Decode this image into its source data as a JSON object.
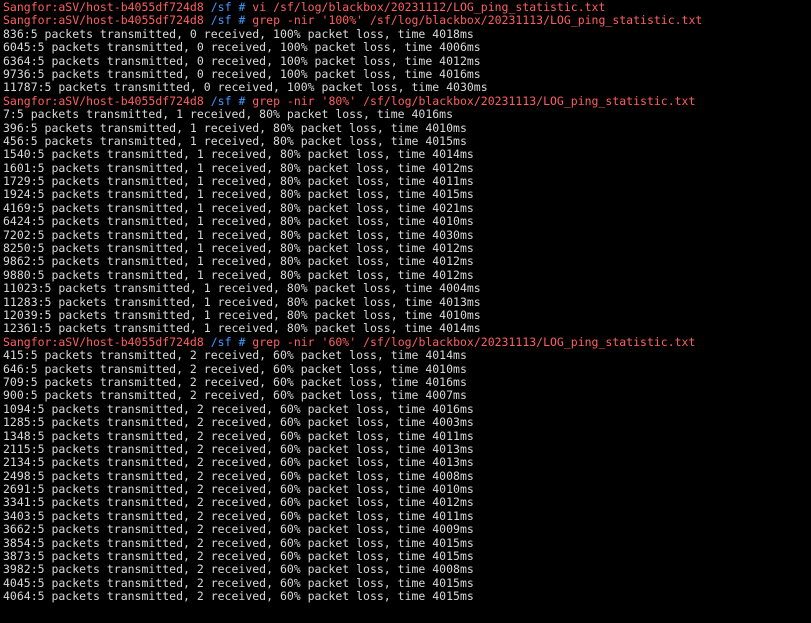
{
  "terminal": {
    "colors": {
      "background": "#000000",
      "text": "#d9d9d9",
      "prompt_host": "#ff5f5f",
      "prompt_path": "#3f9bff"
    },
    "lines": [
      {
        "type": "prompt",
        "host": "Sangfor:aSV/host-b4055df724d8",
        "path": "/sf",
        "cmd": "vi /sf/log/blackbox/20231112/LOG_ping_statistic.txt"
      },
      {
        "type": "prompt",
        "host": "Sangfor:aSV/host-b4055df724d8",
        "path": "/sf",
        "cmd": "grep -nir '100%' /sf/log/blackbox/20231113/LOG_ping_statistic.txt"
      },
      {
        "type": "out",
        "text": "836:5 packets transmitted, 0 received, 100% packet loss, time 4018ms"
      },
      {
        "type": "out",
        "text": "6045:5 packets transmitted, 0 received, 100% packet loss, time 4006ms"
      },
      {
        "type": "out",
        "text": "6364:5 packets transmitted, 0 received, 100% packet loss, time 4012ms"
      },
      {
        "type": "out",
        "text": "9736:5 packets transmitted, 0 received, 100% packet loss, time 4016ms"
      },
      {
        "type": "out",
        "text": "11787:5 packets transmitted, 0 received, 100% packet loss, time 4030ms"
      },
      {
        "type": "prompt",
        "host": "Sangfor:aSV/host-b4055df724d8",
        "path": "/sf",
        "cmd": "grep -nir '80%' /sf/log/blackbox/20231113/LOG_ping_statistic.txt"
      },
      {
        "type": "out",
        "text": "7:5 packets transmitted, 1 received, 80% packet loss, time 4016ms"
      },
      {
        "type": "out",
        "text": "396:5 packets transmitted, 1 received, 80% packet loss, time 4010ms"
      },
      {
        "type": "out",
        "text": "456:5 packets transmitted, 1 received, 80% packet loss, time 4015ms"
      },
      {
        "type": "out",
        "text": "1540:5 packets transmitted, 1 received, 80% packet loss, time 4014ms"
      },
      {
        "type": "out",
        "text": "1601:5 packets transmitted, 1 received, 80% packet loss, time 4012ms"
      },
      {
        "type": "out",
        "text": "1729:5 packets transmitted, 1 received, 80% packet loss, time 4011ms"
      },
      {
        "type": "out",
        "text": "1924:5 packets transmitted, 1 received, 80% packet loss, time 4015ms"
      },
      {
        "type": "out",
        "text": "4169:5 packets transmitted, 1 received, 80% packet loss, time 4021ms"
      },
      {
        "type": "out",
        "text": "6424:5 packets transmitted, 1 received, 80% packet loss, time 4010ms"
      },
      {
        "type": "out",
        "text": "7202:5 packets transmitted, 1 received, 80% packet loss, time 4030ms"
      },
      {
        "type": "out",
        "text": "8250:5 packets transmitted, 1 received, 80% packet loss, time 4012ms"
      },
      {
        "type": "out",
        "text": "9862:5 packets transmitted, 1 received, 80% packet loss, time 4012ms"
      },
      {
        "type": "out",
        "text": "9880:5 packets transmitted, 1 received, 80% packet loss, time 4012ms"
      },
      {
        "type": "out",
        "text": "11023:5 packets transmitted, 1 received, 80% packet loss, time 4004ms"
      },
      {
        "type": "out",
        "text": "11283:5 packets transmitted, 1 received, 80% packet loss, time 4013ms"
      },
      {
        "type": "out",
        "text": "12039:5 packets transmitted, 1 received, 80% packet loss, time 4010ms"
      },
      {
        "type": "out",
        "text": "12361:5 packets transmitted, 1 received, 80% packet loss, time 4014ms"
      },
      {
        "type": "prompt",
        "host": "Sangfor:aSV/host-b4055df724d8",
        "path": "/sf",
        "cmd": "grep -nir '60%' /sf/log/blackbox/20231113/LOG_ping_statistic.txt"
      },
      {
        "type": "out",
        "text": "415:5 packets transmitted, 2 received, 60% packet loss, time 4014ms"
      },
      {
        "type": "out",
        "text": "646:5 packets transmitted, 2 received, 60% packet loss, time 4010ms"
      },
      {
        "type": "out",
        "text": "709:5 packets transmitted, 2 received, 60% packet loss, time 4016ms"
      },
      {
        "type": "out",
        "text": "900:5 packets transmitted, 2 received, 60% packet loss, time 4007ms"
      },
      {
        "type": "out",
        "text": "1094:5 packets transmitted, 2 received, 60% packet loss, time 4016ms"
      },
      {
        "type": "out",
        "text": "1285:5 packets transmitted, 2 received, 60% packet loss, time 4003ms"
      },
      {
        "type": "out",
        "text": "1348:5 packets transmitted, 2 received, 60% packet loss, time 4011ms"
      },
      {
        "type": "out",
        "text": "2115:5 packets transmitted, 2 received, 60% packet loss, time 4013ms"
      },
      {
        "type": "out",
        "text": "2134:5 packets transmitted, 2 received, 60% packet loss, time 4013ms"
      },
      {
        "type": "out",
        "text": "2498:5 packets transmitted, 2 received, 60% packet loss, time 4008ms"
      },
      {
        "type": "out",
        "text": "2691:5 packets transmitted, 2 received, 60% packet loss, time 4010ms"
      },
      {
        "type": "out",
        "text": "3341:5 packets transmitted, 2 received, 60% packet loss, time 4012ms"
      },
      {
        "type": "out",
        "text": "3403:5 packets transmitted, 2 received, 60% packet loss, time 4011ms"
      },
      {
        "type": "out",
        "text": "3662:5 packets transmitted, 2 received, 60% packet loss, time 4009ms"
      },
      {
        "type": "out",
        "text": "3854:5 packets transmitted, 2 received, 60% packet loss, time 4015ms"
      },
      {
        "type": "out",
        "text": "3873:5 packets transmitted, 2 received, 60% packet loss, time 4015ms"
      },
      {
        "type": "out",
        "text": "3982:5 packets transmitted, 2 received, 60% packet loss, time 4008ms"
      },
      {
        "type": "out",
        "text": "4045:5 packets transmitted, 2 received, 60% packet loss, time 4015ms"
      },
      {
        "type": "out",
        "text": "4064:5 packets transmitted, 2 received, 60% packet loss, time 4015ms"
      }
    ]
  }
}
